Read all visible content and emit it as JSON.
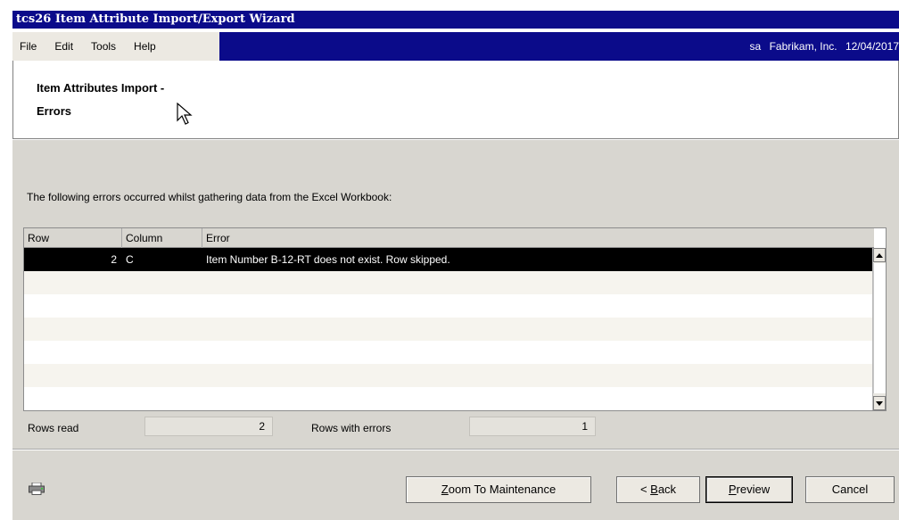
{
  "window": {
    "title": "tcs26 Item Attribute Import/Export Wizard"
  },
  "menu": {
    "items": [
      "File",
      "Edit",
      "Tools",
      "Help"
    ],
    "status_user": "sa",
    "status_company": "Fabrikam, Inc.",
    "status_date": "12/04/2017"
  },
  "header": {
    "title_line1": "Item Attributes Import -",
    "title_line2": "Errors"
  },
  "message": "The following errors occurred whilst gathering data from the Excel Workbook:",
  "grid": {
    "columns": [
      "Row",
      "Column",
      "Error"
    ],
    "rows": [
      {
        "row": "2",
        "column": "C",
        "error": "Item Number B-12-RT does not exist. Row skipped."
      }
    ]
  },
  "stats": {
    "rows_read_label": "Rows read",
    "rows_read_value": "2",
    "rows_errors_label": "Rows with errors",
    "rows_errors_value": "1"
  },
  "buttons": {
    "zoom": {
      "accel": "Z",
      "rest": "oom To Maintenance"
    },
    "back": {
      "pre": "< ",
      "accel": "B",
      "rest": "ack"
    },
    "preview": {
      "accel": "P",
      "rest": "review"
    },
    "cancel": "Cancel"
  },
  "icons": {
    "cursor": "arrow-cursor-icon",
    "printer": "printer-icon",
    "scroll_up": "triangle-up-icon",
    "scroll_down": "triangle-down-icon"
  }
}
